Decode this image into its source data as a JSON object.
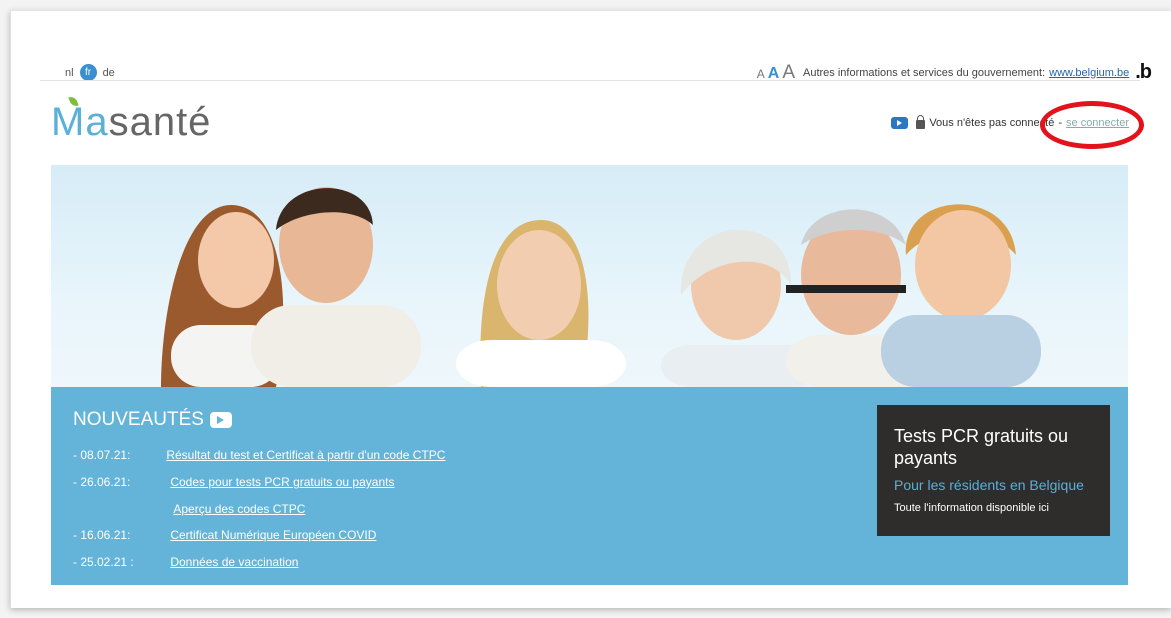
{
  "languages": {
    "nl": "nl",
    "fr": "fr",
    "de": "de"
  },
  "font_size_controls": [
    "A",
    "A",
    "A"
  ],
  "gov_info": {
    "text": "Autres informations et services du gouvernement:",
    "link": "www.belgium.be",
    "logo": ".b"
  },
  "logo": {
    "ma": "Ma",
    "sante": "santé"
  },
  "login": {
    "status": "Vous n'êtes pas connecté",
    "separator": "-",
    "link": "se connecter"
  },
  "news": {
    "title": "NOUVEAUTÉS",
    "items": [
      {
        "date": "- 08.07.21:",
        "text": "Résultat du test et Certificat à partir d'un code CTPC"
      },
      {
        "date": "- 26.06.21:",
        "text": "Codes pour tests PCR gratuits ou payants"
      },
      {
        "date": "",
        "text": "Aperçu des codes CTPC"
      },
      {
        "date": "- 16.06.21:",
        "text": "Certificat Numérique Européen COVID"
      },
      {
        "date": "- 25.02.21 :",
        "text": "Données de vaccination"
      }
    ]
  },
  "pcr": {
    "title": "Tests PCR gratuits ou payants",
    "subtitle": "Pour les résidents en Belgique",
    "link": "Toute l'information disponible ici"
  },
  "colors": {
    "accent": "#3a8fd0",
    "news_bg": "#64b3d8",
    "pcr_bg": "#2f2d2b",
    "highlight": "#e3131b"
  }
}
